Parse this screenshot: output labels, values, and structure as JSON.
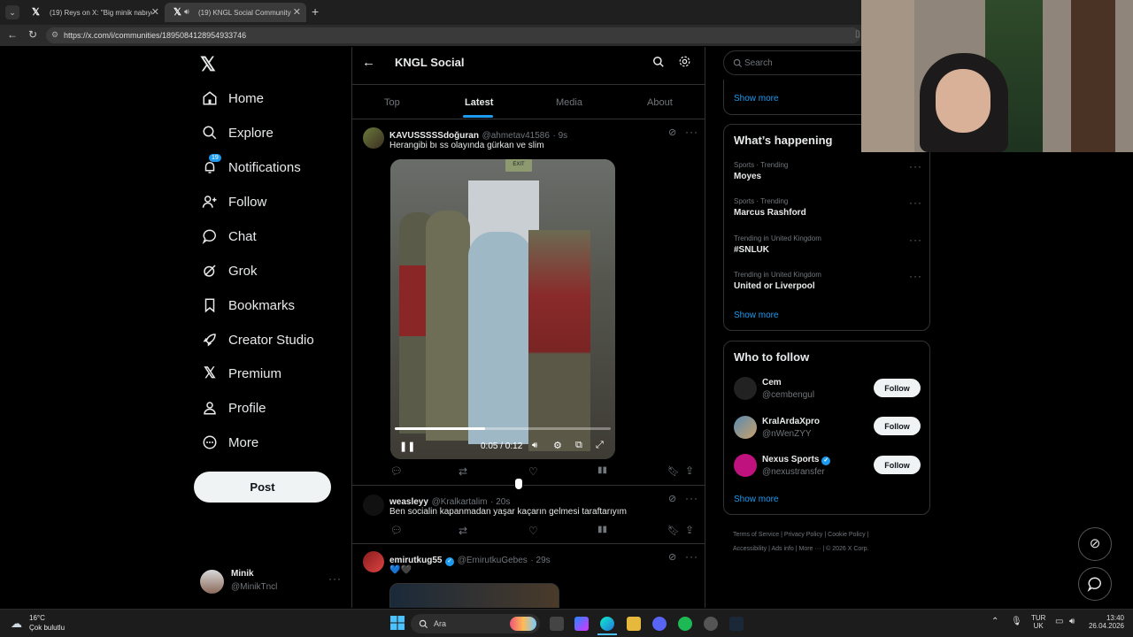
{
  "browser": {
    "tabs": [
      {
        "title": "(19) Reys on X: \"Big minik nabıyon\""
      },
      {
        "title": "(19) KNGL Social Community"
      }
    ],
    "url": "https://x.com/i/communities/1895084128954933746"
  },
  "sidebar": {
    "items": [
      {
        "label": "Home"
      },
      {
        "label": "Explore"
      },
      {
        "label": "Notifications",
        "badge": "19"
      },
      {
        "label": "Follow"
      },
      {
        "label": "Chat"
      },
      {
        "label": "Grok"
      },
      {
        "label": "Bookmarks"
      },
      {
        "label": "Creator Studio"
      },
      {
        "label": "Premium"
      },
      {
        "label": "Profile"
      },
      {
        "label": "More"
      }
    ],
    "post_label": "Post",
    "account": {
      "name": "Minik",
      "handle": "@MinikTncl"
    }
  },
  "header": {
    "title": "KNGL Social"
  },
  "tabs": [
    "Top",
    "Latest",
    "Media",
    "About"
  ],
  "active_tab": "Latest",
  "tweets": [
    {
      "name": "KAVUSSSSSdoğuran",
      "handle": "@ahmetav41586",
      "time": "· 9s",
      "text": "Herangibi bı ss olayında gürkan ve slim",
      "video_time": "0:05 / 0:12",
      "video_progress": 0.42
    },
    {
      "name": "weasleyy",
      "handle": "@Kralkartalim",
      "time": "· 20s",
      "text": "Ben socialin kapanmadan yaşar kaçarın gelmesi taraftarıyım"
    },
    {
      "name": "emirutkug55",
      "handle": "@EmirutkuGebes",
      "time": "· 29s",
      "text": "💙🖤"
    }
  ],
  "search": {
    "placeholder": "Search"
  },
  "show_more": "Show more",
  "happening": {
    "title": "What’s happening",
    "trends": [
      {
        "context": "Sports · Trending",
        "name": "Moyes"
      },
      {
        "context": "Sports · Trending",
        "name": "Marcus Rashford"
      },
      {
        "context": "Trending in United Kingdom",
        "name": "#SNLUK"
      },
      {
        "context": "Trending in United Kingdom",
        "name": "United or Liverpool"
      }
    ]
  },
  "who_to_follow": {
    "title": "Who to follow",
    "follow_label": "Follow",
    "users": [
      {
        "name": "Cem",
        "handle": "@cembengul"
      },
      {
        "name": "KralArdaXpro",
        "handle": "@nWenZYY"
      },
      {
        "name": "Nexus Sports",
        "handle": "@nexustransfer",
        "verified": true
      }
    ]
  },
  "footer_links": [
    "Terms of Service",
    "Privacy Policy",
    "Cookie Policy",
    "Accessibility",
    "Ads info",
    "More ···",
    "© 2026 X Corp."
  ],
  "taskbar": {
    "weather_temp": "16°C",
    "weather_text": "Çok bulutlu",
    "search": "Ara",
    "lang": "TUR",
    "region": "UK",
    "time": "13:40",
    "date": "26.04.2026"
  },
  "colors": {
    "accent": "#1d9bf0",
    "bg": "#000000",
    "border": "#2f3336"
  }
}
